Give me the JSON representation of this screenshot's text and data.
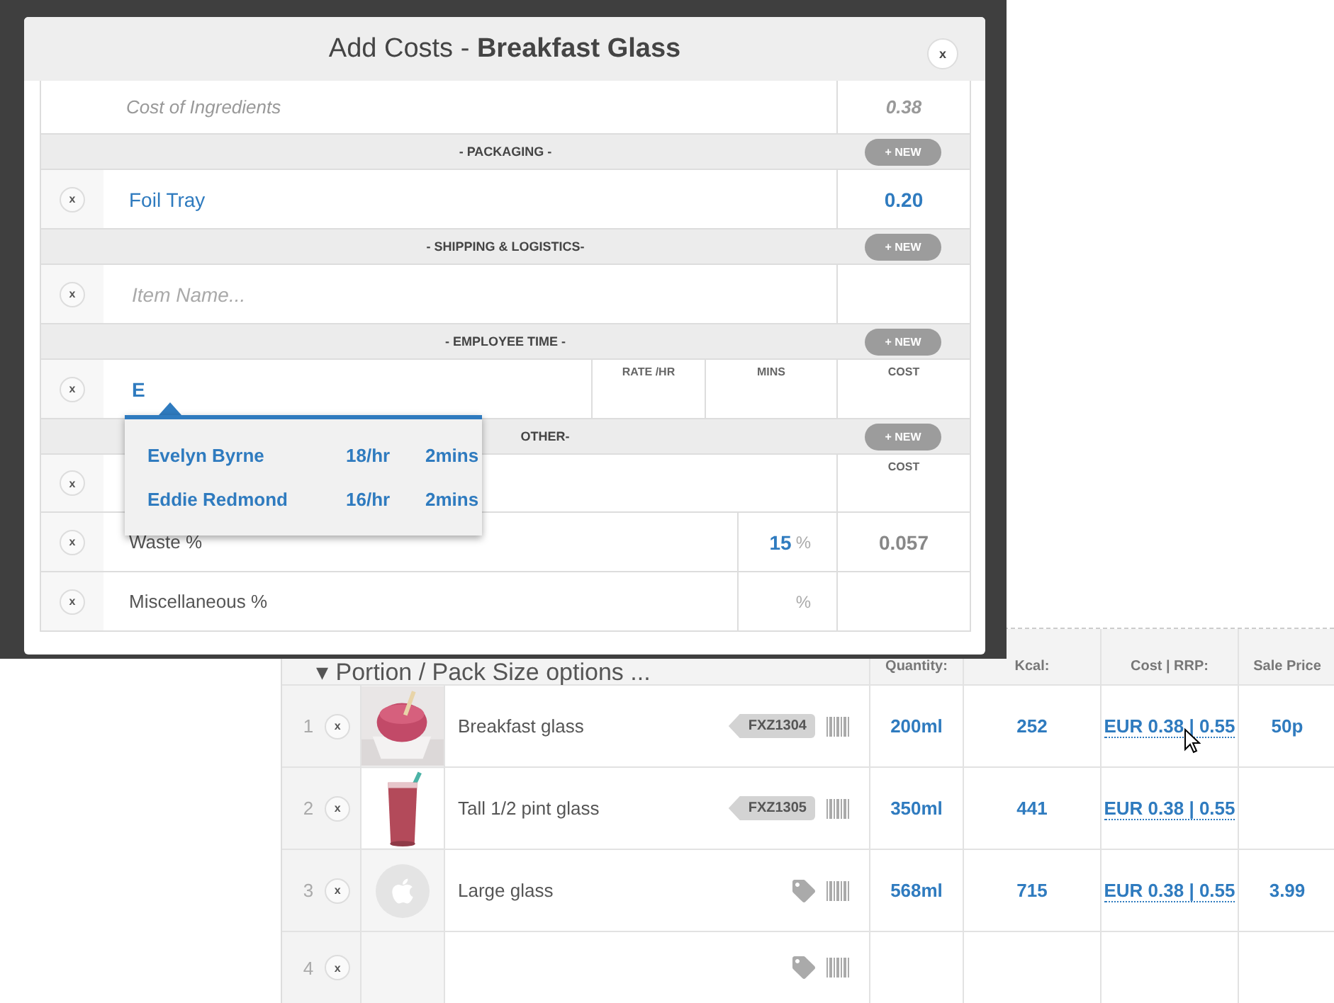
{
  "product_table": {
    "toggle": "▾",
    "title": "Portion / Pack Size options ...",
    "columns": [
      "Quantity:",
      "Kcal:",
      "Cost | RRP:",
      "Sale Price"
    ],
    "rows": [
      {
        "index": "1",
        "remove": "x",
        "name": "Breakfast glass",
        "code": "FXZ1304",
        "quantity": "200ml",
        "kcal": "252",
        "cost": "EUR 0.38 | 0.55",
        "sale_price": "50p"
      },
      {
        "index": "2",
        "remove": "x",
        "name": "Tall 1/2 pint glass",
        "code": "FXZ1305",
        "quantity": "350ml",
        "kcal": "441",
        "cost": "EUR 0.38 | 0.55"
      },
      {
        "index": "3",
        "remove": "x",
        "kind": "placeholder",
        "name": "Large glass",
        "quantity": "568ml",
        "kcal": "715",
        "cost": "EUR 0.38 | 0.55",
        "sale_price": "3.99"
      },
      {
        "index": "4",
        "remove": "x",
        "kind": "empty"
      }
    ]
  },
  "modal": {
    "title": "Add Costs - **Breakfast Glass**",
    "close": "x",
    "rows": [
      {
        "kind": "summary",
        "label": "Cost of Ingredients",
        "value": "0.38"
      },
      {
        "kind": "section",
        "label": "- PACKAGING -",
        "button": "+ NEW"
      },
      {
        "kind": "item",
        "remove": "x",
        "name": "Foil Tray",
        "value": "0.20"
      },
      {
        "kind": "section",
        "label": "- SHIPPING & LOGISTICS-",
        "button": "+ NEW"
      },
      {
        "kind": "item",
        "remove": "x",
        "placeholder": "Item Name..."
      },
      {
        "kind": "section",
        "label": "- EMPLOYEE TIME -",
        "button": "+ NEW"
      },
      {
        "kind": "employee",
        "remove": "x",
        "value": "E",
        "columns": [
          "RATE /HR",
          "MINS",
          "COST"
        ]
      },
      {
        "kind": "section",
        "label": "OTHER-",
        "button": "+ NEW",
        "offset": true
      },
      {
        "kind": "other",
        "remove": "x",
        "columns": [
          "COST"
        ]
      },
      {
        "kind": "percent",
        "remove": "x",
        "label": "Waste %",
        "percent": "15",
        "unit": "%",
        "value": "0.057"
      },
      {
        "kind": "percent",
        "remove": "x",
        "label": "Miscellaneous %",
        "unit": "%"
      }
    ],
    "suggestions": [
      {
        "name": "Evelyn Byrne",
        "rate": "18/hr",
        "mins": "2mins"
      },
      {
        "name": "Eddie Redmond",
        "rate": "16/hr",
        "mins": "2mins"
      }
    ]
  }
}
